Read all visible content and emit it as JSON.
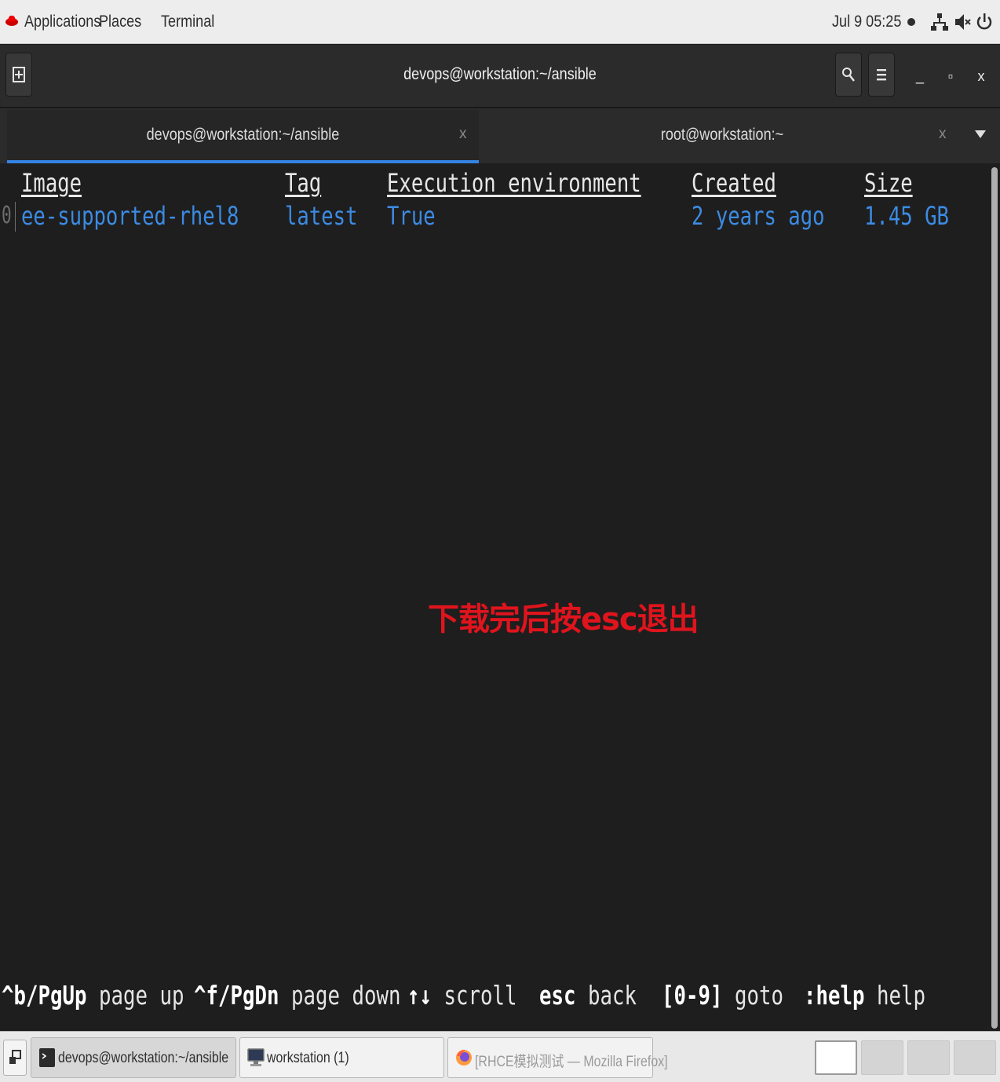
{
  "topbar": {
    "applications": "Applications",
    "places": "Places",
    "terminal": "Terminal",
    "clock": "Jul 9  05:25",
    "icons": [
      "redhat-logo-icon",
      "network-icon",
      "volume-muted-icon",
      "power-icon"
    ]
  },
  "window": {
    "title": "devops@workstation:~/ansible",
    "controls": {
      "minimize": "_",
      "maximize": "▫",
      "close": "x"
    }
  },
  "tabs": [
    {
      "label": "devops@workstation:~/ansible",
      "close": "x",
      "active": true
    },
    {
      "label": "root@workstation:~",
      "close": "x",
      "active": false
    }
  ],
  "table": {
    "headers": [
      "Image",
      "Tag",
      "Execution environment",
      "Created",
      "Size"
    ],
    "row_index": "0",
    "row": [
      "ee-supported-rhel8",
      "latest",
      "True",
      "2 years ago",
      "1.45 GB"
    ]
  },
  "annotation": "下载完后按esc退出",
  "footer": [
    {
      "key": "^b/PgUp",
      "action": "page up"
    },
    {
      "key": "^f/PgDn",
      "action": "page down"
    },
    {
      "key": "↑↓",
      "action": "scroll"
    },
    {
      "key": "esc",
      "action": "back"
    },
    {
      "key": "[0-9]",
      "action": "goto"
    },
    {
      "key": ":help",
      "action": "help"
    }
  ],
  "taskbar": {
    "windows": [
      {
        "label": "devops@workstation:~/ansible",
        "active": true
      },
      {
        "label": "workstation (1)",
        "active": false
      },
      {
        "label": "[RHCE模拟测试 — Mozilla Firefox]",
        "active": false
      }
    ]
  },
  "colors": {
    "terminal_bg": "#1e1e1e",
    "row_text": "#3c8be3",
    "tab_accent": "#3584e4",
    "annotation": "#e0141d"
  }
}
